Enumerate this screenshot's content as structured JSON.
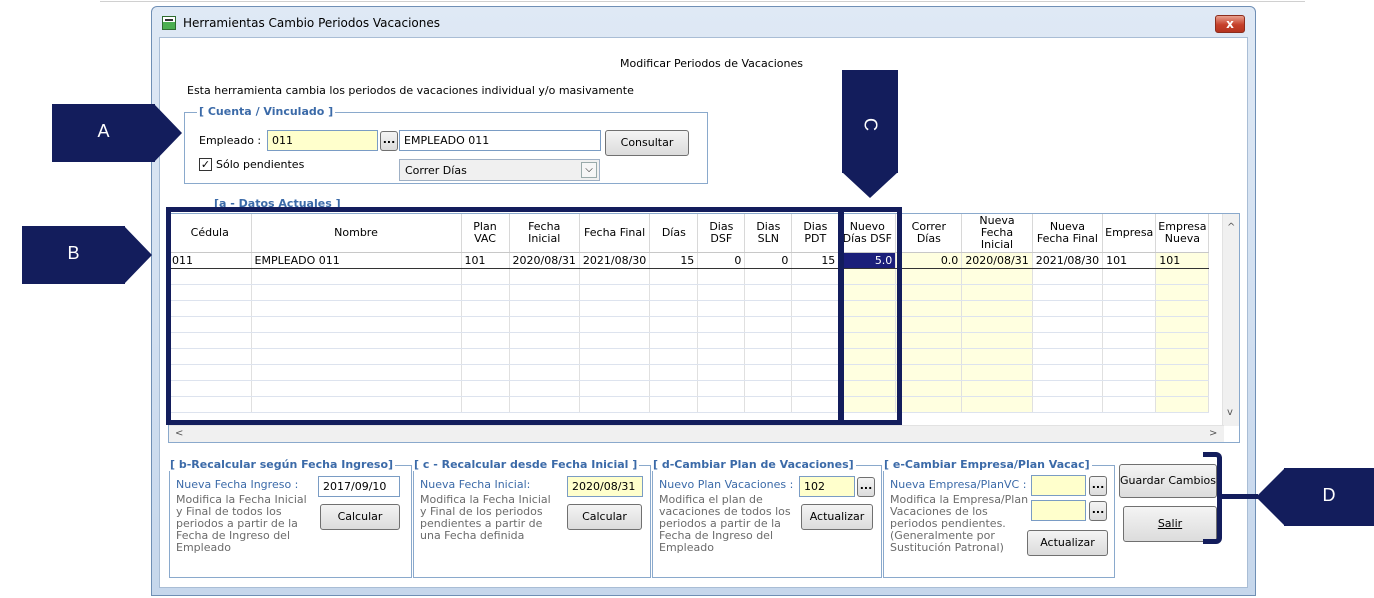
{
  "window": {
    "title": "Herramientas Cambio Periodos Vacaciones",
    "close_label": "x"
  },
  "header": {
    "title": "Modificar Periodos de Vacaciones",
    "description": "Esta herramienta cambia los periodos de vacaciones individual y/o masivamente"
  },
  "cuenta": {
    "legend": "[ Cuenta / Vinculado ]",
    "empleado_label": "Empleado :",
    "empleado_value": "011",
    "browse_label": "...",
    "nombre_value": "EMPLEADO 011",
    "consultar_label": "Consultar",
    "solo_pendientes_label": "Sólo pendientes",
    "solo_pendientes_checked": true,
    "check_mark": "✓",
    "mode_value": "Correr Días",
    "combo_arrow": "⌵"
  },
  "grid": {
    "legend": "[a - Datos Actuales ]",
    "columns": [
      "Cédula",
      "Nombre",
      "Plan VAC",
      "Fecha Inicial",
      "Fecha Final",
      "Días",
      "Dias DSF",
      "Dias SLN",
      "Dias PDT",
      "Nuevo Días DSF",
      "Correr Días",
      "Nueva Fecha Inicial",
      "Nueva Fecha Final",
      "Empresa",
      "Empresa Nueva"
    ],
    "rows": [
      [
        "011",
        "EMPLEADO 011",
        "101",
        "2020/08/31",
        "2021/08/30",
        "15",
        "0",
        "0",
        "15",
        "5.0",
        "0.0",
        "2020/08/31",
        "2021/08/30",
        "101",
        "101"
      ]
    ],
    "scroll_up": "^",
    "scroll_down": "v",
    "scroll_left": "<",
    "scroll_right": ">"
  },
  "panel_b": {
    "legend": "[ b-Recalcular según Fecha Ingreso]",
    "label": "Nueva Fecha Ingreso :",
    "value": "2017/09/10",
    "description": [
      "Modifica la Fecha Inicial",
      "y Final de todos los",
      "periodos a partir de la",
      "Fecha de Ingreso del",
      "Empleado"
    ],
    "button": "Calcular"
  },
  "panel_c": {
    "legend": "[ c - Recalcular desde Fecha Inicial ]",
    "label": "Nueva Fecha Inicial:",
    "value": "2020/08/31",
    "description": [
      "Modifica la Fecha Inicial",
      "y Final de los periodos",
      "pendientes a partir de",
      "una Fecha definida"
    ],
    "button": "Calcular"
  },
  "panel_d": {
    "legend": "[ d-Cambiar Plan de Vacaciones]",
    "label": "Nuevo Plan Vacaciones :",
    "value": "102",
    "browse_label": "...",
    "description": [
      "Modifica el plan de",
      "vacaciones de todos los",
      "periodos a partir de la",
      "Fecha de Ingreso del",
      "Empleado"
    ],
    "button": "Actualizar"
  },
  "panel_e": {
    "legend": "[ e-Cambiar Empresa/Plan Vacac]",
    "label": "Nueva Empresa/PlanVC :",
    "browse_label": "...",
    "description": [
      "Modifica la Empresa/Plan",
      "Vacaciones de los",
      "periodos pendientes.",
      "(Generalmente por",
      "Sustitución Patronal)"
    ],
    "button": "Actualizar"
  },
  "actions": {
    "guardar_label": "Guardar Cambios",
    "salir_label": "Salir"
  },
  "callouts": {
    "a": "A",
    "b": "B",
    "c": "C",
    "d": "D"
  },
  "colors": {
    "callout": "#131d5c",
    "legend": "#3b6aa8",
    "input_yellow": "#ffffcc",
    "selected_cell": "#1b1f7a"
  }
}
